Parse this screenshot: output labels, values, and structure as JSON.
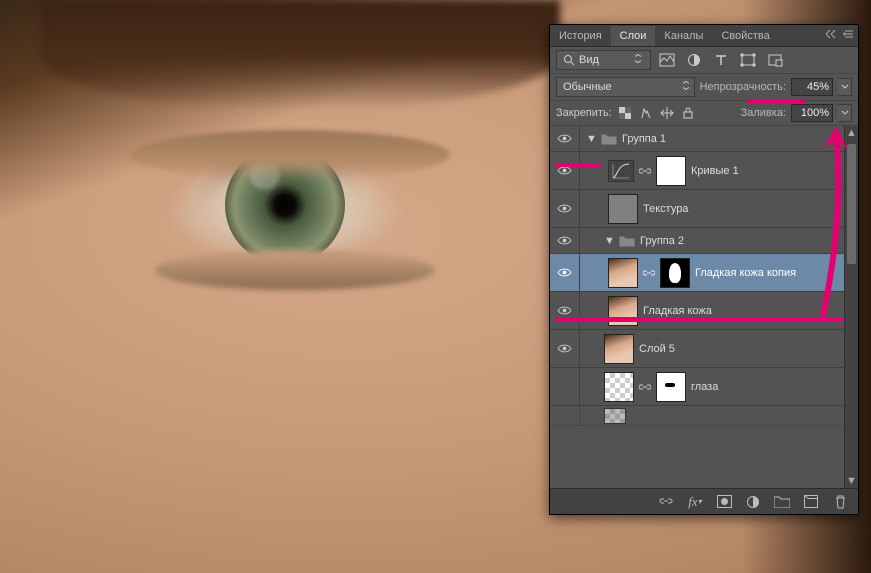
{
  "tabs": {
    "history": "История",
    "layers": "Слои",
    "channels": "Каналы",
    "properties": "Свойства"
  },
  "filter": {
    "label": "Вид"
  },
  "blend": {
    "mode": "Обычные"
  },
  "opacity": {
    "label": "Непрозрачность:",
    "value": "45%"
  },
  "lockrow": {
    "label": "Закрепить:"
  },
  "fill": {
    "label": "Заливка:",
    "value": "100%"
  },
  "layers": {
    "g1": "Группа 1",
    "curves1": "Кривые 1",
    "texture": "Текстура",
    "g2": "Группа 2",
    "smooth_copy": "Гладкая кожа копия",
    "smooth": "Гладкая кожа",
    "layer5": "Слой 5",
    "eyes": "глаза"
  }
}
